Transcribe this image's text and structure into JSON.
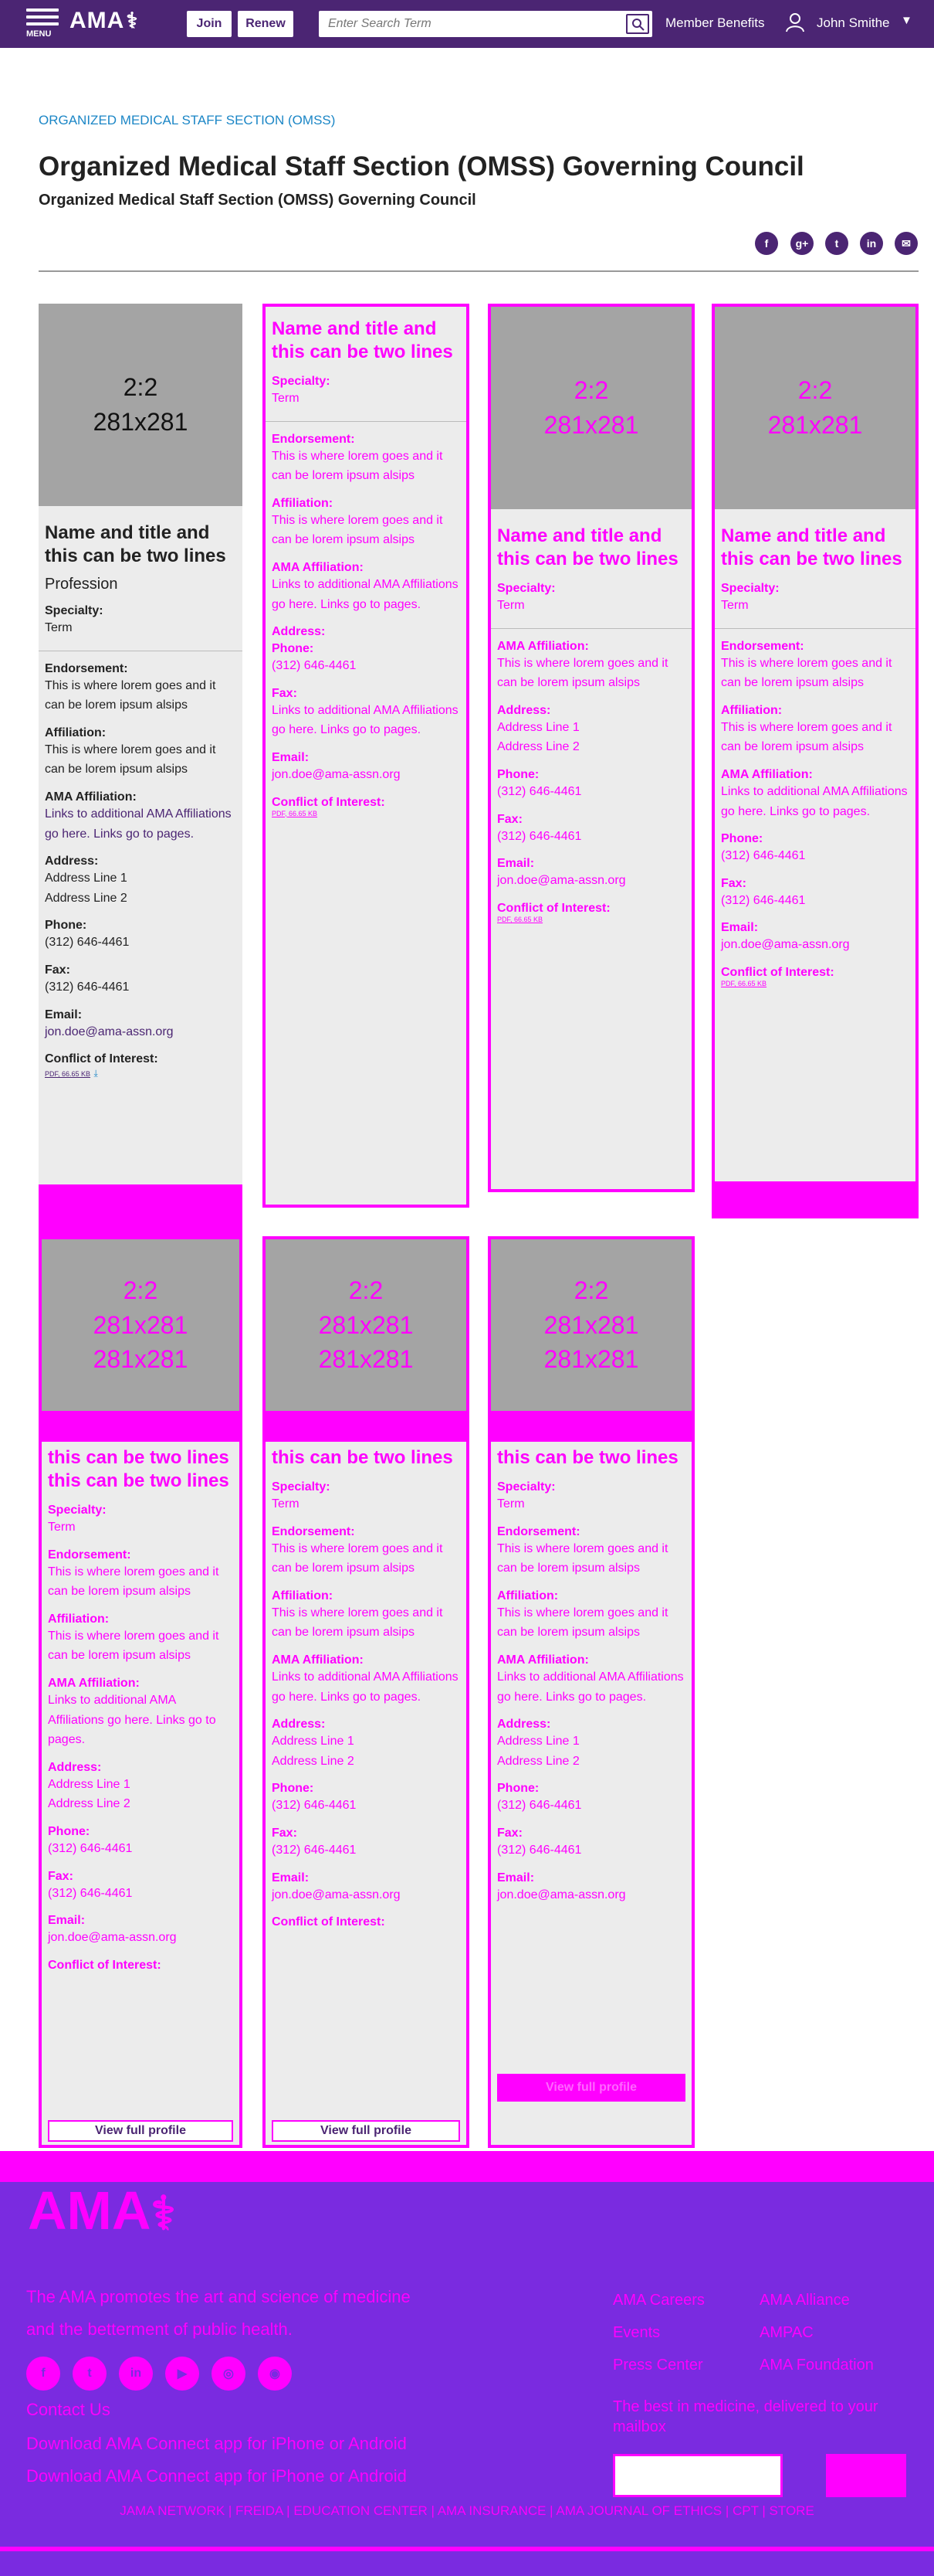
{
  "header": {
    "menu_label": "MENU",
    "logo_text": "AMA",
    "join_label": "Join",
    "renew_label": "Renew",
    "search_placeholder": "Enter Search Term",
    "member_benefits": "Member Benefits",
    "user_name": "John Smithe"
  },
  "page": {
    "breadcrumb": "ORGANIZED MEDICAL STAFF SECTION (OMSS)",
    "title": "Organized Medical Staff Section (OMSS) Governing Council",
    "subtitle": "Organized Medical Staff Section (OMSS) Governing Council"
  },
  "share_icons": [
    "facebook-icon",
    "google-plus-icon",
    "twitter-icon",
    "linkedin-icon",
    "email-icon"
  ],
  "card": {
    "photo_ratio": "2:2",
    "photo_size": "281x281",
    "name": "Name and title and this can be two lines",
    "name_tail": "this can be two lines",
    "profession": "Profession",
    "specialty_label": "Specialty:",
    "specialty": "Term",
    "endorsement_label": "Endorsement:",
    "endorsement": "This is where lorem goes and it can be lorem ipsum alsips",
    "affiliation_label": "Affiliation:",
    "affiliation": "This is where lorem goes and it can be lorem ipsum alsips",
    "ama_affiliation_label": "AMA Affiliation:",
    "ama_affiliation": "Links to additional AMA Affiliations go here. Links go to pages.",
    "address_label": "Address:",
    "address1": "Address Line 1",
    "address2": "Address Line 2",
    "phone_label": "Phone:",
    "phone": "(312) 646-4461",
    "fax_label": "Fax:",
    "fax": "(312) 646-4461",
    "email_label": "Email:",
    "email": "jon.doe@ama-assn.org",
    "coi_label": "Conflict of Interest:",
    "coi_file": "PDF, 66.65 KB",
    "view_profile": "View full profile"
  },
  "footer": {
    "logo_text": "AMA",
    "mission": "The AMA promotes the art and science of medicine and the betterment of public health.",
    "contact": "Contact Us",
    "download": "Download AMA Connect app for iPhone or Android",
    "links_col1": [
      "AMA Careers",
      "Events",
      "Press Center"
    ],
    "links_col2": [
      "AMA Alliance",
      "AMPAC",
      "AMA Foundation"
    ],
    "newsletter": "The best in medicine, delivered to your mailbox",
    "bottom_nav": "JAMA NETWORK  |  FREIDA  |  EDUCATION CENTER  |  AMA INSURANCE  |  AMA JOURNAL OF ETHICS  |  CPT  |  STORE"
  },
  "colors": {
    "brand": "#4b2573",
    "link": "#1b86c6",
    "footer": "#7a2be0",
    "artifact": "#ff00ff"
  }
}
